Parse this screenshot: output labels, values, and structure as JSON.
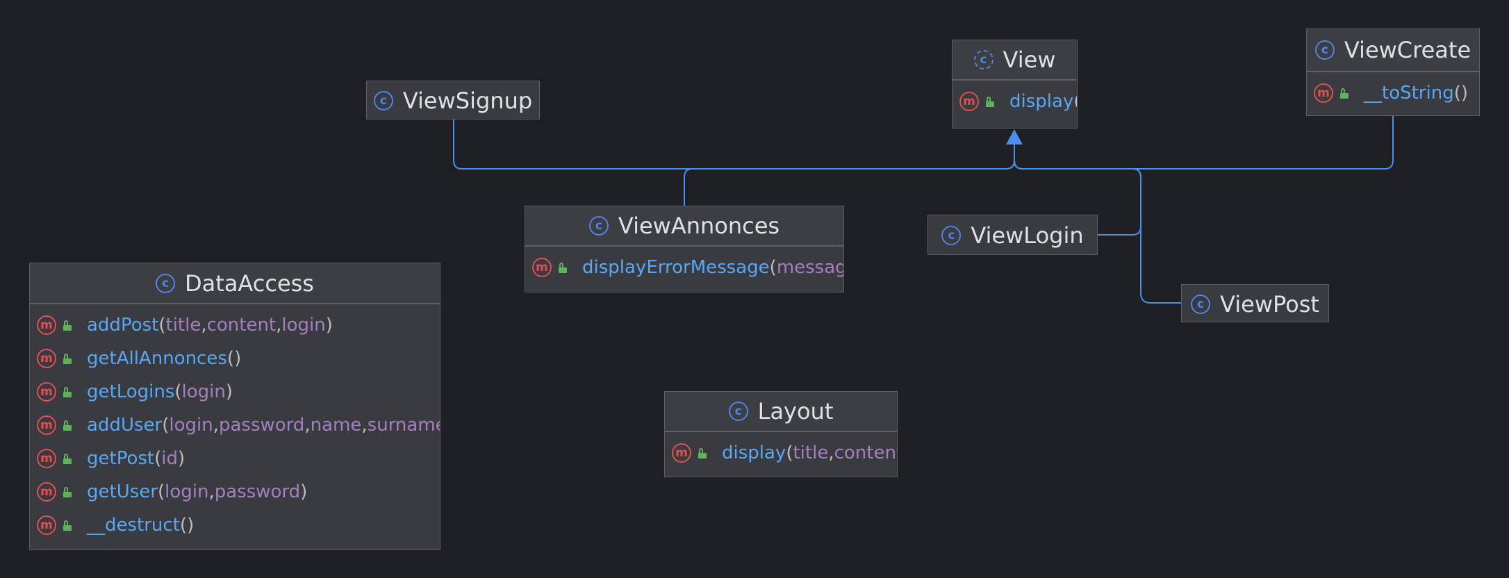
{
  "diagram": {
    "background": "#1e1f22",
    "edge_color": "#4b8ef0",
    "relationship": "extends",
    "classes": [
      {
        "id": "View",
        "name": "View",
        "abstract": true,
        "methods": [
          {
            "name": "display",
            "params": [],
            "closed": false
          }
        ]
      },
      {
        "id": "ViewCreate",
        "name": "ViewCreate",
        "abstract": false,
        "methods": [
          {
            "name": "__toString",
            "params": [],
            "closed": true
          }
        ]
      },
      {
        "id": "ViewSignup",
        "name": "ViewSignup",
        "abstract": false,
        "methods": []
      },
      {
        "id": "ViewAnnonces",
        "name": "ViewAnnonces",
        "abstract": false,
        "methods": [
          {
            "name": "displayErrorMessage",
            "params": [
              "message"
            ],
            "closed": false
          }
        ]
      },
      {
        "id": "ViewLogin",
        "name": "ViewLogin",
        "abstract": false,
        "methods": []
      },
      {
        "id": "ViewPost",
        "name": "ViewPost",
        "abstract": false,
        "methods": []
      },
      {
        "id": "DataAccess",
        "name": "DataAccess",
        "abstract": false,
        "methods": [
          {
            "name": "addPost",
            "params": [
              "title",
              "content",
              "login"
            ],
            "closed": true
          },
          {
            "name": "getAllAnnonces",
            "params": [],
            "closed": true
          },
          {
            "name": "getLogins",
            "params": [
              "login"
            ],
            "closed": true
          },
          {
            "name": "addUser",
            "params": [
              "login",
              "password",
              "name",
              "surname"
            ],
            "closed": false
          },
          {
            "name": "getPost",
            "params": [
              "id"
            ],
            "closed": true
          },
          {
            "name": "getUser",
            "params": [
              "login",
              "password"
            ],
            "closed": true
          },
          {
            "name": "__destruct",
            "params": [],
            "closed": true
          }
        ]
      },
      {
        "id": "Layout",
        "name": "Layout",
        "abstract": false,
        "methods": [
          {
            "name": "display",
            "params": [
              "title",
              "content"
            ],
            "closed": false
          }
        ]
      }
    ],
    "edges": [
      {
        "from": "ViewSignup",
        "to": "View"
      },
      {
        "from": "ViewAnnonces",
        "to": "View"
      },
      {
        "from": "ViewCreate",
        "to": "View"
      },
      {
        "from": "ViewLogin",
        "to": "View"
      },
      {
        "from": "ViewPost",
        "to": "View"
      }
    ]
  }
}
